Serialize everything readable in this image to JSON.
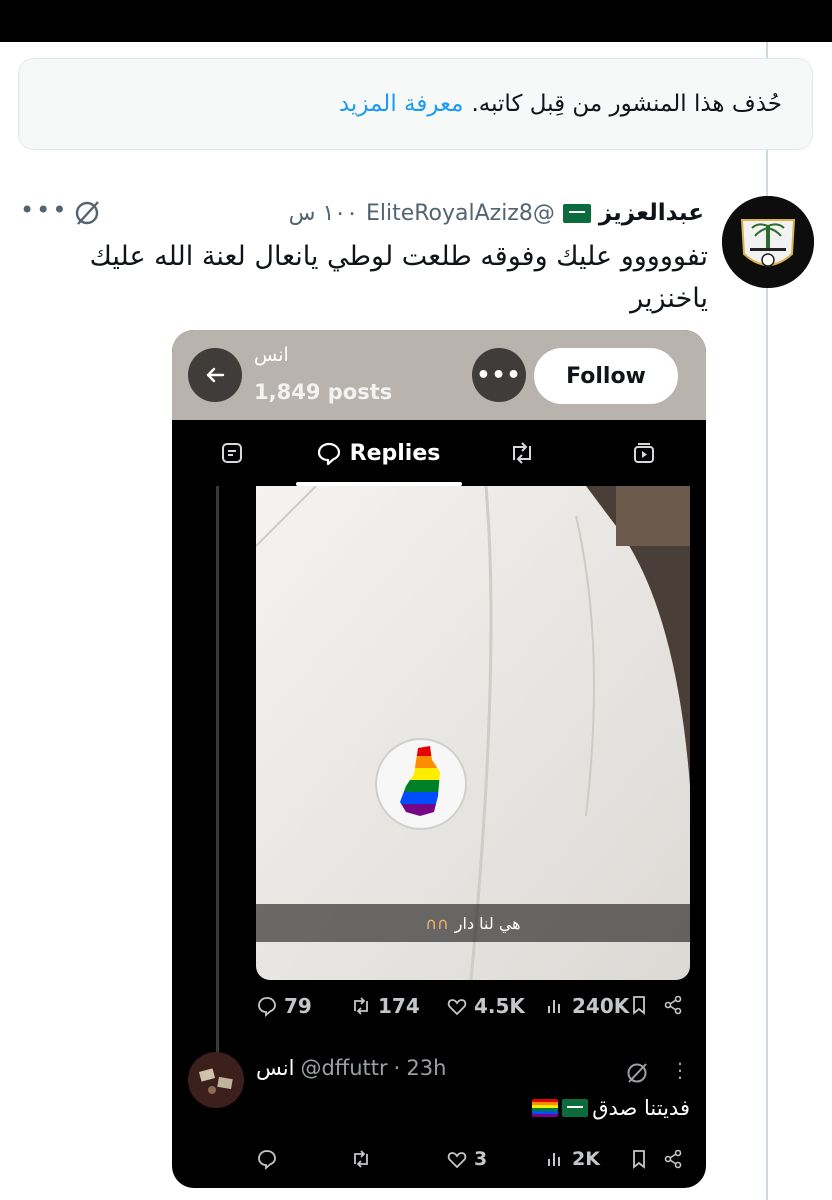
{
  "notice": {
    "text": "حُذف هذا المنشور من قِبل كاتبه.",
    "link": "معرفة المزيد"
  },
  "post": {
    "author_name": "عبدالعزيز",
    "author_handle": "@EliteRoyalAziz8",
    "time": "١٠٠ س",
    "text": "تفووووو عليك وفوقه طلعت لوطي يانعال لعنة الله عليك ياخنزير",
    "flag_icon": "saudi-flag-icon",
    "more": "•••"
  },
  "embed": {
    "profile_name": "انس",
    "posts_count": "1,849 posts",
    "more_label": "•••",
    "follow_label": "Follow",
    "tabs": [
      {
        "name": "posts",
        "icon": "posts-icon"
      },
      {
        "name": "replies",
        "label": "Replies",
        "icon": "reply-bubble-icon"
      },
      {
        "name": "reposts",
        "icon": "repost-icon"
      },
      {
        "name": "media",
        "icon": "media-icon"
      }
    ],
    "media_caption": "هي لنا دار",
    "stats": {
      "replies": "79",
      "reposts": "174",
      "likes": "4.5K",
      "views": "240K"
    },
    "reply": {
      "name": "انس",
      "handle": "@dffuttr",
      "separator": "·",
      "time": "23h",
      "text": "فديتنا صدق",
      "more": "⋮",
      "stats": {
        "likes": "3",
        "views": "2K"
      }
    }
  },
  "colors": {
    "link": "#1d9bf0",
    "secondary_text": "#536471",
    "embed_bg": "#000000",
    "embed_header_bg": "#b9b3ad"
  }
}
